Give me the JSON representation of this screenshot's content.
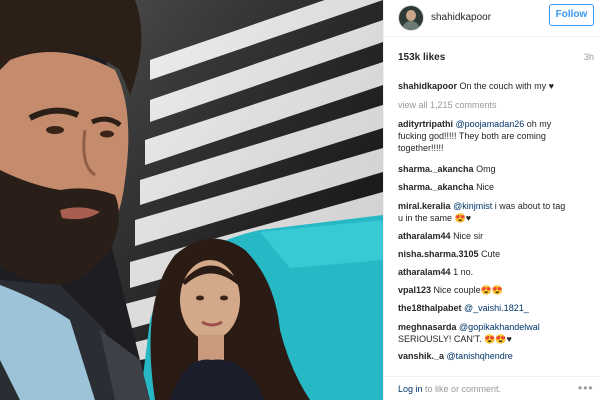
{
  "post": {
    "username": "shahidkapoor",
    "follow_label": "Follow",
    "likes": "153k likes",
    "age": "3h"
  },
  "caption": {
    "user": "shahidkapoor",
    "text": "On the couch with my",
    "emoji": "♥"
  },
  "view_all": "view all 1,215 comments",
  "comments": [
    {
      "user": "adityrtripathi",
      "mention": "@poojamadan26",
      "text_1": " oh my",
      "text_2": "fucking god!!!!! They both are coming",
      "text_3": "together!!!!!"
    },
    {
      "user": "sharma._akancha",
      "text": "Omg"
    },
    {
      "user": "sharma._akancha",
      "text": "Nice"
    },
    {
      "user": "miral.keralia",
      "mention": "@kinjmist",
      "text_1": " i was about to tag",
      "text_2": "u in the same 😍♥"
    },
    {
      "user": "atharalam44",
      "text": "Nice sir"
    },
    {
      "user": "nisha.sharma.3105",
      "text": "Cute"
    },
    {
      "user": "atharalam44",
      "text": "1 no."
    },
    {
      "user": "vpal123",
      "text": "Nice couple😍😍"
    },
    {
      "user": "the18thalpabet",
      "mention": "@_vaishi.1821_",
      "text": ""
    },
    {
      "user": "meghnasarda",
      "mention": "@gopikakhandelwal",
      "text_2": "SERIOUSLY! CAN'T. 😍😍♥"
    },
    {
      "user": "vanshik._a",
      "mention": "@tanishqhendre",
      "text": ""
    }
  ],
  "footer": {
    "login": "Log in",
    "login_rest": " to like or comment.",
    "more": "•••"
  },
  "icons": {
    "heart": "heart-icon",
    "more": "more-options-icon"
  },
  "colors": {
    "link": "#003569",
    "follow": "#3897f0",
    "muted": "#999999"
  }
}
